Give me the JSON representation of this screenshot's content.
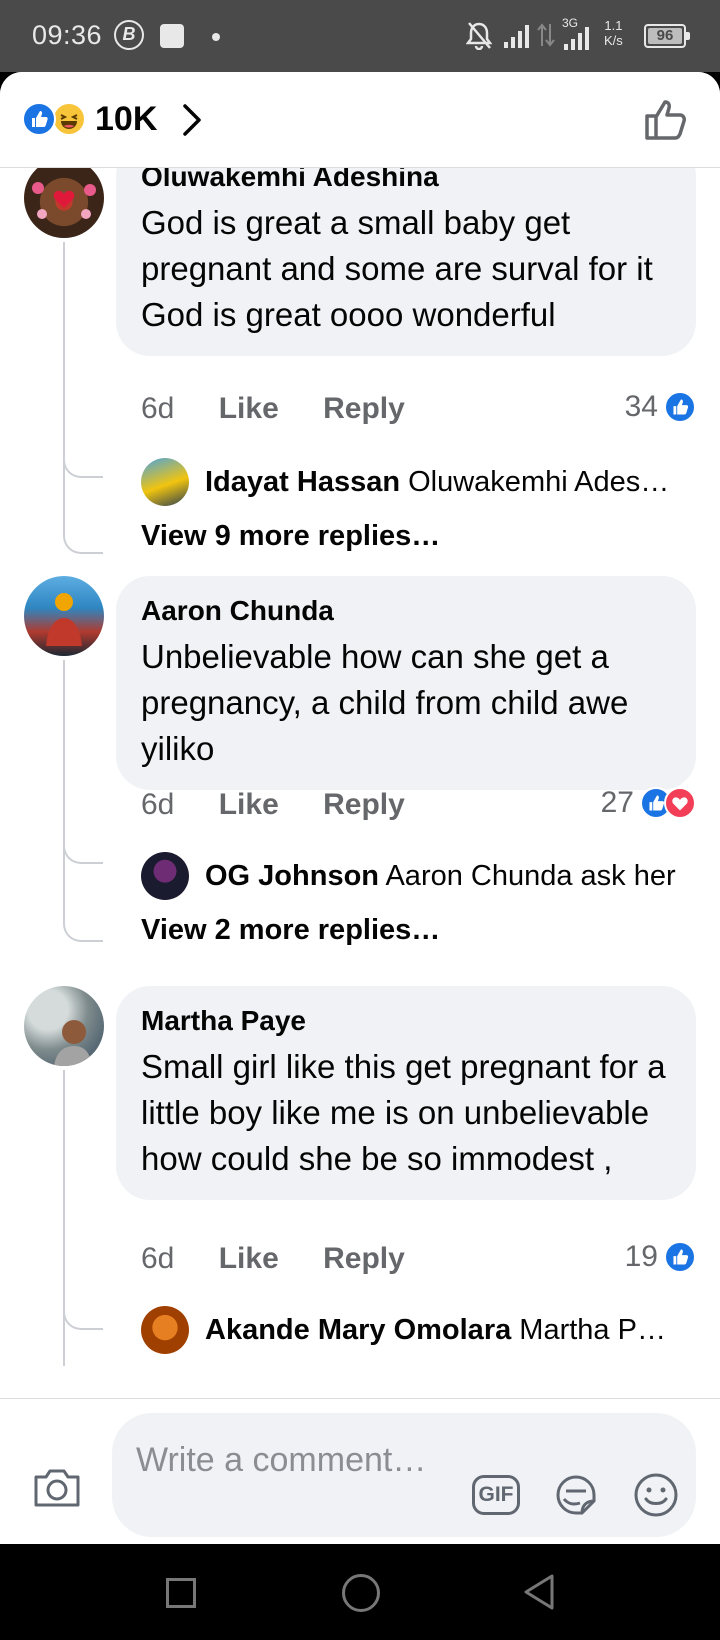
{
  "status_bar": {
    "time": "09:36",
    "network": "3G",
    "speed_value": "1.1",
    "speed_unit": "K/s",
    "battery": "96"
  },
  "header": {
    "reaction_icons": [
      "like-icon",
      "haha-icon"
    ],
    "reaction_count": "10K"
  },
  "comments": [
    {
      "author": "Oluwakemhi Adeshina",
      "text": "God is great a small baby get pregnant and some are surval for it God is great oooo wonderful",
      "age": "6d",
      "like_label": "Like",
      "reply_label": "Reply",
      "reaction_count": "34",
      "reactions": [
        "like"
      ],
      "reply_preview": {
        "author": "Idayat Hassan",
        "text": "Oluwakemhi Ades…"
      },
      "more_replies": "View 9 more replies…"
    },
    {
      "author": "Aaron Chunda",
      "text": "Unbelievable how can she get a pregnancy, a child from child awe yiliko",
      "age": "6d",
      "like_label": "Like",
      "reply_label": "Reply",
      "reaction_count": "27",
      "reactions": [
        "like",
        "love"
      ],
      "reply_preview": {
        "author": "OG Johnson",
        "text": "Aaron Chunda ask her"
      },
      "more_replies": "View 2 more replies…"
    },
    {
      "author": "Martha Paye",
      "text": "Small girl like this get pregnant for a little boy like me is on unbelievable how could she be so immodest ,",
      "age": "6d",
      "like_label": "Like",
      "reply_label": "Reply",
      "reaction_count": "19",
      "reactions": [
        "like"
      ],
      "reply_preview": {
        "author": "Akande Mary Omolara",
        "text": "Martha P…"
      }
    }
  ],
  "composer": {
    "placeholder": "Write a comment…",
    "gif_label": "GIF"
  },
  "colors": {
    "facebook_blue": "#1b74e4",
    "love_red": "#f33e58",
    "bubble_bg": "#f0f2f5",
    "secondary_text": "#65676b"
  }
}
